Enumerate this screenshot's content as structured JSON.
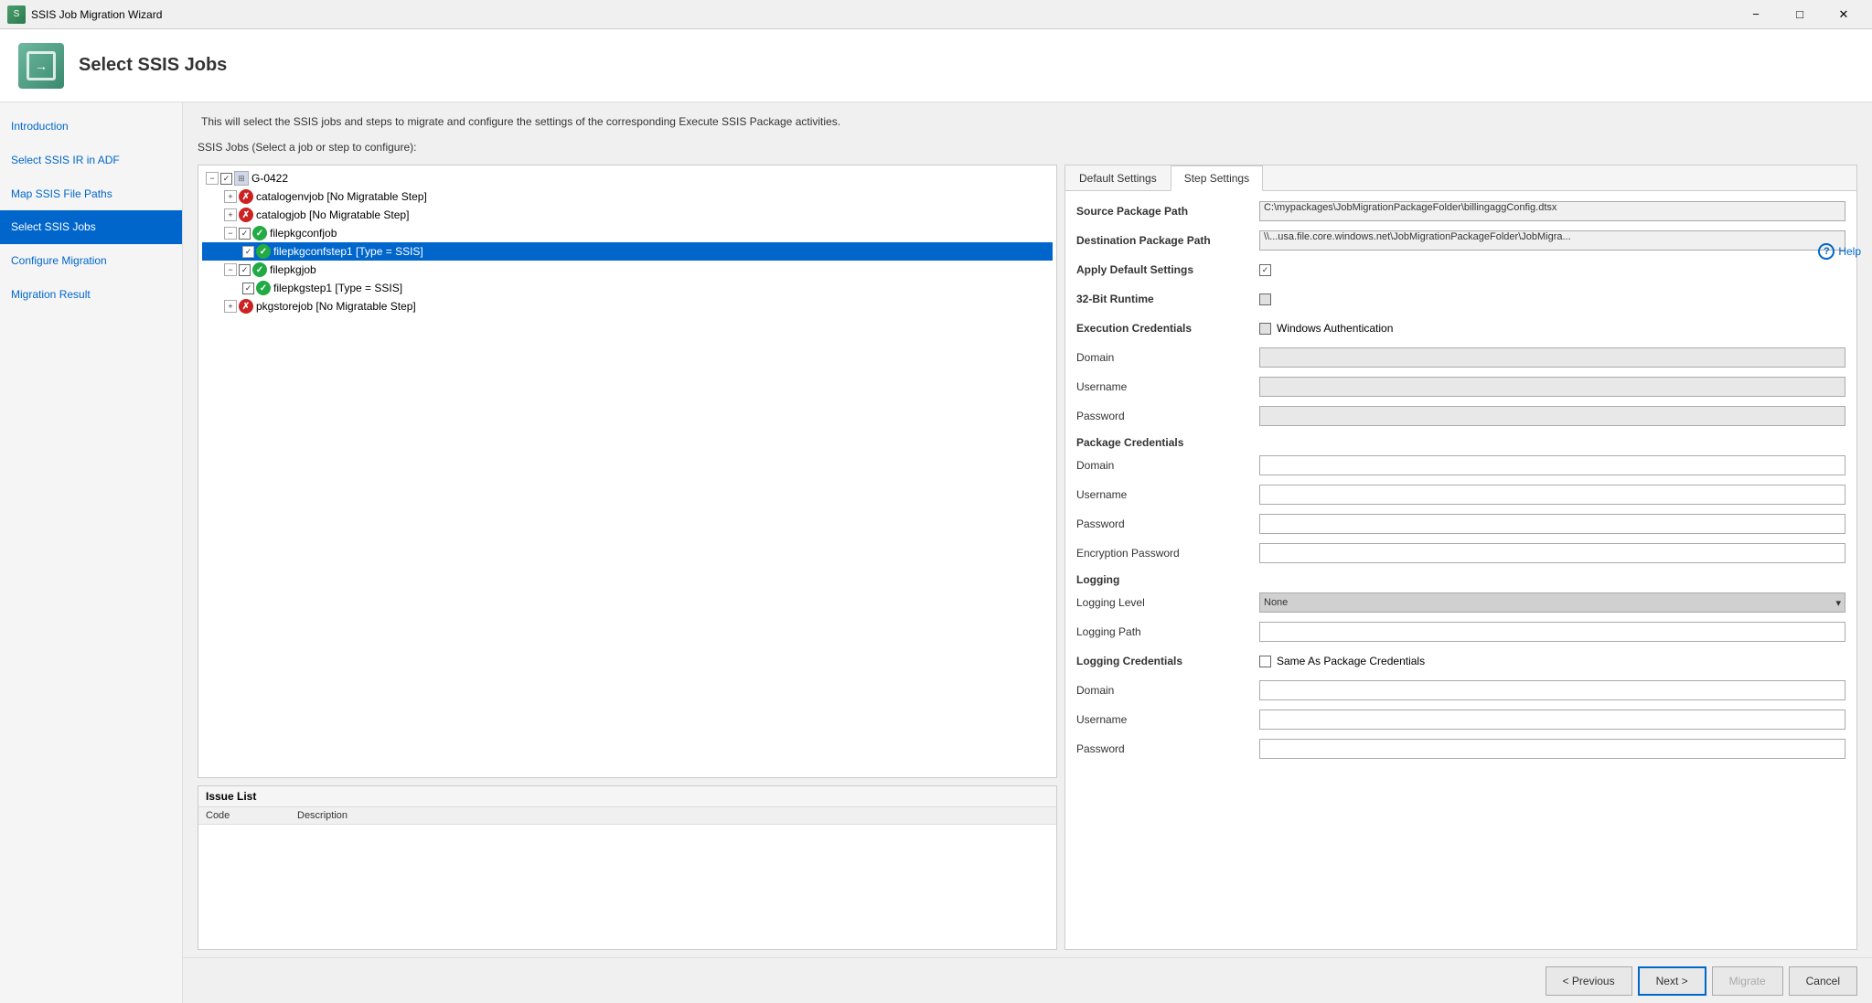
{
  "window": {
    "title": "SSIS Job Migration Wizard",
    "controls": {
      "minimize": "−",
      "maximize": "□",
      "close": "✕"
    }
  },
  "header": {
    "title": "Select SSIS Jobs"
  },
  "help": {
    "label": "Help"
  },
  "sidebar": {
    "items": [
      {
        "id": "introduction",
        "label": "Introduction",
        "active": false
      },
      {
        "id": "select-ssis-ir",
        "label": "Select SSIS IR in ADF",
        "active": false
      },
      {
        "id": "map-ssis-file-paths",
        "label": "Map SSIS File Paths",
        "active": false
      },
      {
        "id": "select-ssis-jobs",
        "label": "Select SSIS Jobs",
        "active": true
      },
      {
        "id": "configure-migration",
        "label": "Configure Migration",
        "active": false
      },
      {
        "id": "migration-result",
        "label": "Migration Result",
        "active": false
      }
    ]
  },
  "description": "This will select the SSIS jobs and steps to migrate and configure the settings of the corresponding Execute SSIS Package activities.",
  "jobs_section_label": "SSIS Jobs (Select a job or step to configure):",
  "tree": {
    "root": {
      "label": "G-0422",
      "expanded": true,
      "children": [
        {
          "label": "catalogenvjob [No Migratable Step]",
          "status": "error",
          "children": []
        },
        {
          "label": "catalogjob [No Migratable Step]",
          "status": "error",
          "children": []
        },
        {
          "label": "filepkgconfjob",
          "status": "ok",
          "checked": true,
          "expanded": true,
          "children": [
            {
              "label": "filepkgconfstep1 [Type = SSIS]",
              "status": "ok",
              "checked": true,
              "selected": true
            }
          ]
        },
        {
          "label": "filepkgjob",
          "status": "ok",
          "checked": true,
          "expanded": true,
          "children": [
            {
              "label": "filepkgstep1 [Type = SSIS]",
              "status": "ok",
              "checked": true
            }
          ]
        },
        {
          "label": "pkgstorejob [No Migratable Step]",
          "status": "error",
          "children": []
        }
      ]
    }
  },
  "issue_list": {
    "header": "Issue List",
    "columns": [
      {
        "id": "code",
        "label": "Code"
      },
      {
        "id": "description",
        "label": "Description"
      }
    ],
    "rows": []
  },
  "tabs": [
    {
      "id": "default-settings",
      "label": "Default Settings"
    },
    {
      "id": "step-settings",
      "label": "Step Settings",
      "active": true
    }
  ],
  "step_settings": {
    "source_package_path": {
      "label": "Source Package Path",
      "value": "C:\\mypackages\\JobMigrationPackageFolder\\billingaggConfig.dtsx"
    },
    "destination_package_path": {
      "label": "Destination Package Path",
      "value": "\\\\...usa.file.core.windows.net\\JobMigrationPackageFolder\\JobMigra..."
    },
    "apply_default_settings": {
      "label": "Apply Default Settings",
      "checked": true
    },
    "runtime_32bit": {
      "label": "32-Bit Runtime",
      "checked": false
    },
    "execution_credentials": {
      "label": "Execution Credentials",
      "windows_auth_label": "Windows Authentication",
      "windows_auth_checked": false
    },
    "domain": {
      "label": "Domain",
      "value": ""
    },
    "username": {
      "label": "Username",
      "value": ""
    },
    "password": {
      "label": "Password",
      "value": ""
    },
    "package_credentials": {
      "label": "Package Credentials"
    },
    "pkg_domain": {
      "label": "Domain",
      "value": ""
    },
    "pkg_username": {
      "label": "Username",
      "value": ""
    },
    "pkg_password": {
      "label": "Password",
      "value": ""
    },
    "encryption_password": {
      "label": "Encryption Password",
      "value": ""
    },
    "logging": {
      "label": "Logging"
    },
    "logging_level": {
      "label": "Logging Level",
      "value": "None"
    },
    "logging_path": {
      "label": "Logging Path",
      "value": ""
    },
    "logging_credentials": {
      "label": "Logging Credentials",
      "same_as_pkg_label": "Same As Package Credentials",
      "same_as_pkg_checked": false
    },
    "log_domain": {
      "label": "Domain",
      "value": ""
    },
    "log_username": {
      "label": "Username",
      "value": ""
    },
    "log_password": {
      "label": "Password",
      "value": ""
    }
  },
  "footer": {
    "previous_label": "< Previous",
    "next_label": "Next >",
    "migrate_label": "Migrate",
    "cancel_label": "Cancel"
  }
}
